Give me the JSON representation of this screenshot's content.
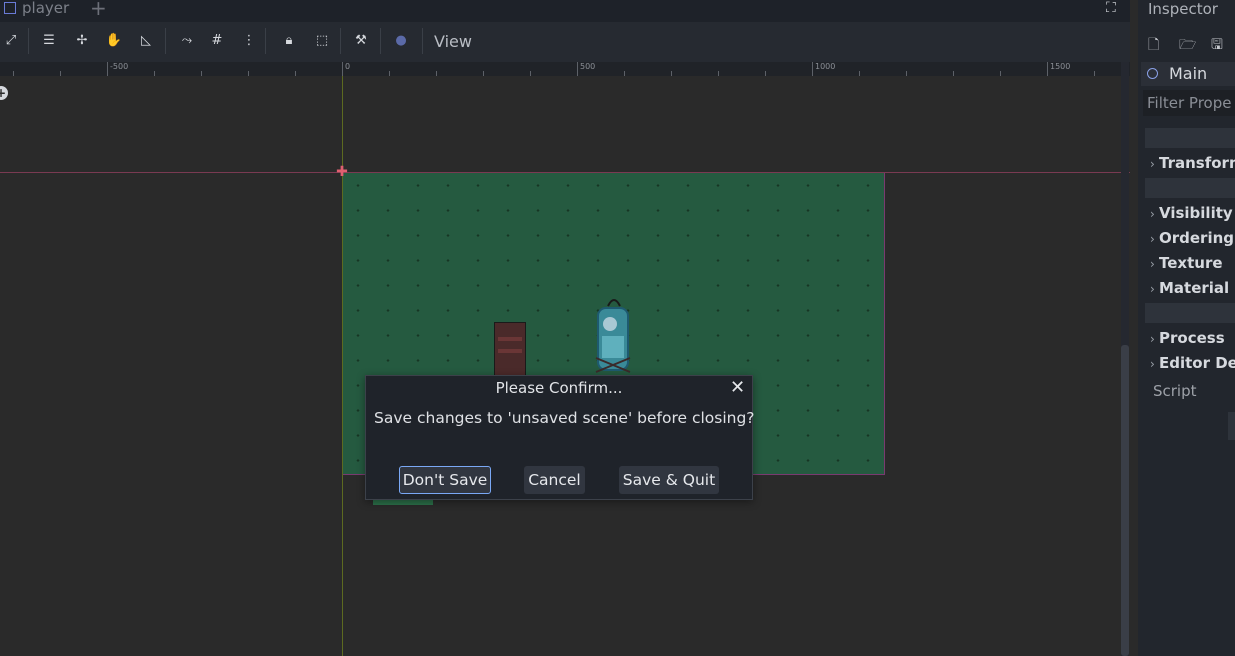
{
  "tabs": {
    "active": "player",
    "add": "+"
  },
  "toolbar": {
    "view_menu": "View"
  },
  "ruler": {
    "labels": [
      "-500",
      "0",
      "500",
      "1000",
      "1500"
    ]
  },
  "inspector": {
    "title": "Inspector",
    "node_name": "Main",
    "filter_placeholder": "Filter Prope",
    "sections": [
      "Transform",
      "Visibility",
      "Ordering",
      "Texture",
      "Material",
      "Process",
      "Editor Des"
    ],
    "script_label": "Script"
  },
  "dialog": {
    "title": "Please Confirm...",
    "message": "Save changes to 'unsaved scene' before closing?",
    "close": "✕",
    "buttons": {
      "dont_save": "Don't Save",
      "cancel": "Cancel",
      "save_quit": "Save & Quit"
    }
  },
  "colors": {
    "accent": "#7aa8f5",
    "map_green": "#255a40",
    "panel_bg": "#22262d"
  }
}
